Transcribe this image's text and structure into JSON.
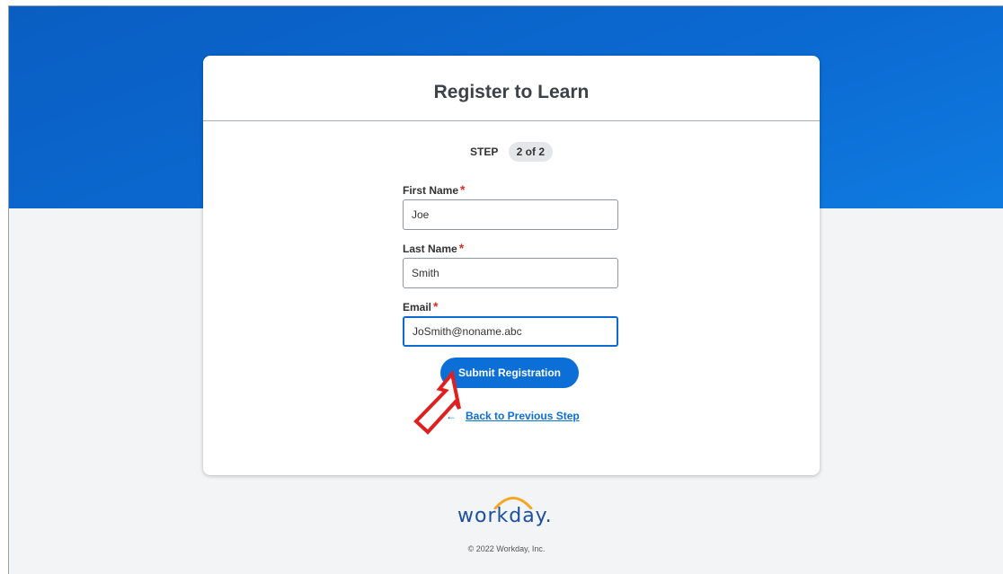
{
  "form": {
    "title": "Register to Learn",
    "step_label": "STEP",
    "step_value": "2 of 2",
    "first_name": {
      "label": "First Name",
      "value": "Joe"
    },
    "last_name": {
      "label": "Last Name",
      "value": "Smith"
    },
    "email": {
      "label": "Email",
      "value": "JoSmith@noname.abc"
    },
    "required_marker": "*",
    "submit_label": "Submit Registration",
    "back_arrow": "←",
    "back_label": "Back to Previous Step"
  },
  "footer": {
    "logo_text": "workday.",
    "copyright": "© 2022 Workday, Inc."
  },
  "colors": {
    "header_blue": "#0b69d1",
    "accent": "#0b6fd7",
    "required": "#d6332c",
    "logo_arc": "#f5a623",
    "annotation_arrow": "#e02020"
  },
  "icons": {
    "annotation": "pointer-arrow-icon",
    "back": "arrow-left-icon",
    "logo": "workday-logo"
  }
}
